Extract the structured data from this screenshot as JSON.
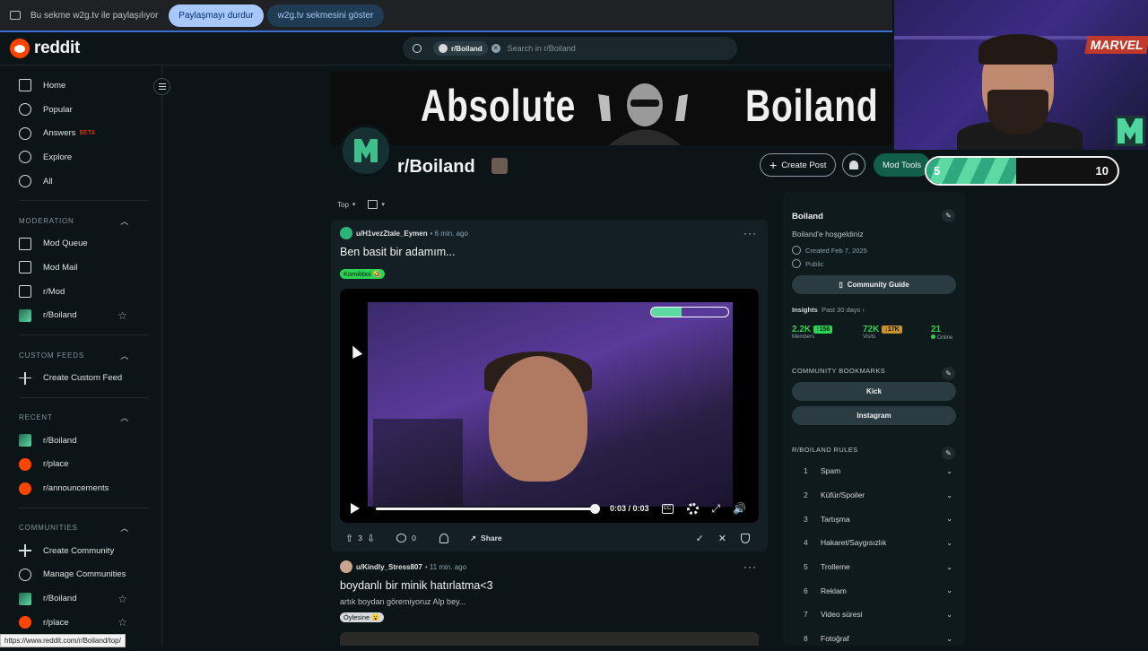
{
  "sharebar": {
    "text": "Bu sekme w2g.tv ile paylaşılıyor",
    "stop_label": "Paylaşmayı durdur",
    "show_label": "w2g.tv sekmesini göster"
  },
  "header": {
    "logo_text": "reddit",
    "search_chip": "r/Boiland",
    "search_placeholder": "Search in r/Boiland"
  },
  "sidebar": {
    "main": [
      {
        "label": "Home",
        "icon": "home-icon"
      },
      {
        "label": "Popular",
        "icon": "popular-icon"
      },
      {
        "label": "Answers",
        "icon": "answers-icon",
        "badge": "BETA"
      },
      {
        "label": "Explore",
        "icon": "explore-icon"
      },
      {
        "label": "All",
        "icon": "all-icon"
      }
    ],
    "moderation_title": "MODERATION",
    "moderation": [
      {
        "label": "Mod Queue"
      },
      {
        "label": "Mod Mail"
      },
      {
        "label": "r/Mod"
      },
      {
        "label": "r/Boiland"
      }
    ],
    "custom_feeds_title": "CUSTOM FEEDS",
    "custom_feeds": [
      {
        "label": "Create Custom Feed"
      }
    ],
    "recent_title": "RECENT",
    "recent": [
      {
        "label": "r/Boiland"
      },
      {
        "label": "r/place"
      },
      {
        "label": "r/announcements"
      }
    ],
    "communities_title": "COMMUNITIES",
    "communities": [
      {
        "label": "Create Community"
      },
      {
        "label": "Manage Communities"
      },
      {
        "label": "r/Boiland"
      },
      {
        "label": "r/place"
      }
    ]
  },
  "banner": {
    "left_text": "Absolute",
    "right_text": "Boiland"
  },
  "community": {
    "name": "r/Boiland",
    "create_post": "Create Post",
    "mod_tools": "Mod Tools"
  },
  "sort": {
    "label": "Top"
  },
  "posts": [
    {
      "user": "u/H1vezZtale_Eymen",
      "time": "• 6 min. ago",
      "title": "Ben basit bir adamım...",
      "flair": "Komikboi 🤣",
      "video_time": "0:03 / 0:03",
      "votes": "3",
      "comments": "0",
      "share": "Share"
    },
    {
      "user": "u/Kindly_Stress807",
      "time": "• 11 min. ago",
      "title": "boydanlı bir minik hatırlatma<3",
      "body": "artık boydan göremiyoruz Alp bey...",
      "flair": "Öylesine 😮"
    }
  ],
  "about": {
    "name": "Boiland",
    "description": "Boiland'e hoşgeldiniz",
    "created": "Created Feb 7, 2025",
    "visibility": "Public",
    "guide_button": "Community Guide",
    "insights_label": "Insights",
    "insights_range": "Past 30 days ›",
    "members_value": "2.2K",
    "members_delta": "↑156",
    "members_label": "Members",
    "visits_value": "72K",
    "visits_delta": "↓17K",
    "visits_label": "Visits",
    "online_value": "21",
    "online_label": "Online",
    "bookmarks_title": "COMMUNITY BOOKMARKS",
    "bookmarks": [
      "Kick",
      "Instagram"
    ],
    "rules_title": "R/BOILAND RULES",
    "rules": [
      {
        "num": "1",
        "label": "Spam"
      },
      {
        "num": "2",
        "label": "Küfür/Spoiler"
      },
      {
        "num": "3",
        "label": "Tartışma"
      },
      {
        "num": "4",
        "label": "Hakaret/Saygısızlık"
      },
      {
        "num": "5",
        "label": "Trolleme"
      },
      {
        "num": "6",
        "label": "Reklam"
      },
      {
        "num": "7",
        "label": "Video süresi"
      },
      {
        "num": "8",
        "label": "Fotoğraf"
      }
    ]
  },
  "overlay": {
    "marvel": "MARVEL",
    "progress_low": "5",
    "progress_high": "10",
    "progress_fraction": 0.47
  },
  "status_url": "https://www.reddit.com/r/Boiland/top/",
  "colors": {
    "accent": "#2bd452",
    "mod_tools_bg": "#115f4b",
    "reddit_orange": "#ff4500"
  }
}
